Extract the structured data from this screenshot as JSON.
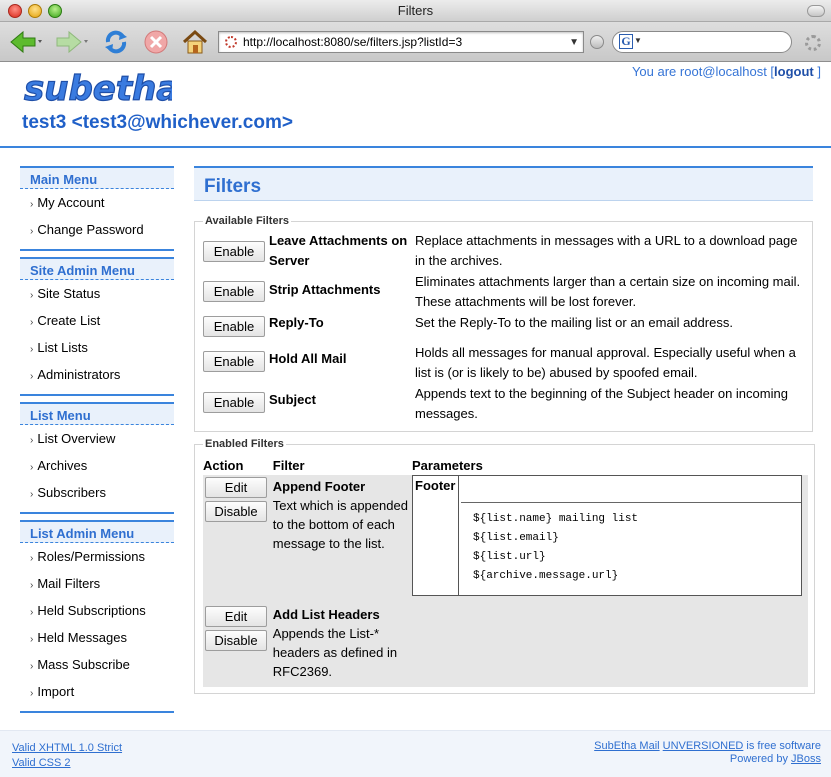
{
  "window": {
    "title": "Filters",
    "url": "http://localhost:8080/se/filters.jsp?listId=3",
    "search_placeholder": ""
  },
  "header": {
    "logo_text": "subetha",
    "user_prefix": "You are root@localhost [",
    "logout_label": "logout",
    "user_suffix": " ]",
    "list_title": "test3 <test3@whichever.com>"
  },
  "sidebar": {
    "main_menu": {
      "title": "Main Menu",
      "items": [
        "My Account",
        "Change Password"
      ]
    },
    "site_admin_menu": {
      "title": "Site Admin Menu",
      "items": [
        "Site Status",
        "Create List",
        "List Lists",
        "Administrators"
      ]
    },
    "list_menu": {
      "title": "List Menu",
      "items": [
        "List Overview",
        "Archives",
        "Subscribers"
      ]
    },
    "list_admin_menu": {
      "title": "List Admin Menu",
      "items": [
        "Roles/Permissions",
        "Mail Filters",
        "Held Subscriptions",
        "Held Messages",
        "Mass Subscribe",
        "Import"
      ]
    }
  },
  "main": {
    "heading": "Filters",
    "available": {
      "legend": "Available Filters",
      "button_label": "Enable",
      "filters": [
        {
          "name": "Leave Attachments on Server",
          "description": "Replace attachments in messages with a URL to a download page in the archives."
        },
        {
          "name": "Strip Attachments",
          "description": "Eliminates attachments larger than a certain size on incoming mail. These attachments will be lost forever."
        },
        {
          "name": "Reply-To",
          "description": "Set the Reply-To to the mailing list or an email address."
        },
        {
          "name": "Hold All Mail",
          "description": "Holds all messages for manual approval. Especially useful when a list is (or is likely to be) abused by spoofed email."
        },
        {
          "name": "Subject",
          "description": "Appends text to the beginning of the Subject header on incoming messages."
        }
      ]
    },
    "enabled": {
      "legend": "Enabled Filters",
      "columns": [
        "Action",
        "Filter",
        "Parameters"
      ],
      "edit_label": "Edit",
      "disable_label": "Disable",
      "filters": [
        {
          "name": "Append Footer",
          "description": "Text which is appended to the bottom of each message to the list.",
          "param_name": "Footer",
          "param_lines": [
            "${list.name} mailing list",
            "${list.email}",
            "${list.url}",
            "${archive.message.url}"
          ]
        },
        {
          "name": "Add List Headers",
          "description": "Appends the List-* headers as defined in RFC2369."
        }
      ]
    }
  },
  "footer": {
    "valid_xhtml": "Valid XHTML 1.0 Strict",
    "valid_css": "Valid CSS 2",
    "product": "SubEtha Mail",
    "version": "UNVERSIONED",
    "free_text": " is free software",
    "powered_by": "Powered by ",
    "jboss": "JBoss"
  },
  "colors": {
    "accent": "#3a84dd",
    "heading_blue": "#2f6fd0",
    "heading_bg": "#e9f1fb",
    "enabled_row_bg": "#e6e6e6"
  }
}
